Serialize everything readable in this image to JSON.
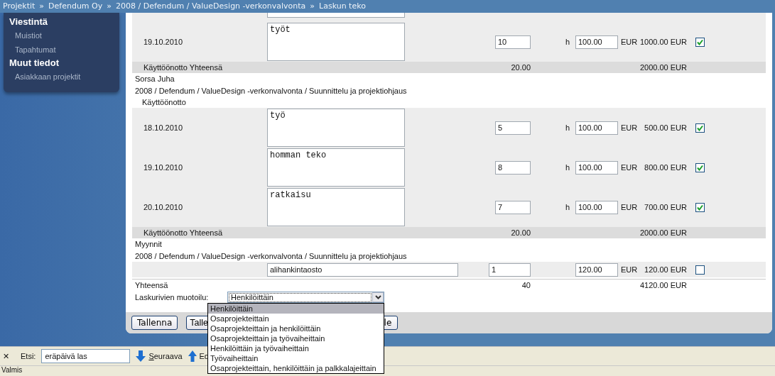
{
  "breadcrumb": [
    "Projektit",
    "Defendum Oy",
    "2008 / Defendum / ValueDesign -verkonvalvonta",
    "Laskun teko"
  ],
  "breadcrumb_separator": "»",
  "sidebar": [
    {
      "label": "Viestintä",
      "kind": "heading"
    },
    {
      "label": "Muistiot",
      "kind": "link"
    },
    {
      "label": "Tapahtumat",
      "kind": "link"
    },
    {
      "label": "Muut tiedot",
      "kind": "heading"
    },
    {
      "label": "Asiakkaan projektit",
      "kind": "link"
    }
  ],
  "lines": [
    {
      "kind": "cut_row"
    },
    {
      "kind": "row",
      "date": "19.10.2010",
      "description": "työt",
      "quantity": "10",
      "unit": "h",
      "price": "100.00",
      "currency": "EUR",
      "total": "1000.00 EUR",
      "checked": true
    },
    {
      "kind": "subtotal",
      "label": "Käyttöönotto Yhteensä",
      "quantity": "20.00",
      "total": "2000.00 EUR"
    },
    {
      "kind": "person",
      "label": "Sorsa Juha"
    },
    {
      "kind": "project",
      "label": "2008 / Defendum / ValueDesign -verkonvalvonta / Suunnittelu ja projektiohjaus"
    },
    {
      "kind": "phase",
      "label": "Käyttöönotto"
    },
    {
      "kind": "row",
      "date": "18.10.2010",
      "description": "työ",
      "quantity": "5",
      "unit": "h",
      "price": "100.00",
      "currency": "EUR",
      "total": "500.00 EUR",
      "checked": true
    },
    {
      "kind": "row",
      "date": "19.10.2010",
      "description": "homman teko",
      "quantity": "8",
      "unit": "h",
      "price": "100.00",
      "currency": "EUR",
      "total": "800.00 EUR",
      "checked": true
    },
    {
      "kind": "row",
      "date": "20.10.2010",
      "description": "ratkaisu",
      "quantity": "7",
      "unit": "h",
      "price": "100.00",
      "currency": "EUR",
      "total": "700.00 EUR",
      "checked": true
    },
    {
      "kind": "subtotal",
      "label": "Käyttöönotto Yhteensä",
      "quantity": "20.00",
      "total": "2000.00 EUR"
    },
    {
      "kind": "person",
      "label": "Myynnit"
    },
    {
      "kind": "project",
      "label": "2008 / Defendum / ValueDesign -verkonvalvonta / Suunnittelu ja projektiohjaus"
    },
    {
      "kind": "sales_row",
      "description": "alihankintaosto",
      "quantity": "1",
      "price": "120.00",
      "currency": "EUR",
      "total": "120.00 EUR",
      "checked": false
    },
    {
      "kind": "total",
      "label": "Yhteensä",
      "quantity": "40",
      "total": "4120.00 EUR"
    }
  ],
  "format": {
    "label": "Laskurivien muotoilu:",
    "value": "Henkilöittäin",
    "expanded": true,
    "options": [
      {
        "label": "Henkilöittäin",
        "selected": true
      },
      {
        "label": "Osaprojekteittain",
        "selected": false
      },
      {
        "label": "Osaprojekteittain ja henkilöittäin",
        "selected": false
      },
      {
        "label": "Osaprojekteittain ja työvaiheittain",
        "selected": false
      },
      {
        "label": "Henkilöittäin ja työvaiheittain",
        "selected": false
      },
      {
        "label": "Työvaiheittain",
        "selected": false
      },
      {
        "label": "Osaprojekteittain, henkilöittäin ja palkkalajeittain",
        "selected": false
      }
    ]
  },
  "buttons": [
    {
      "label": "Tallenna"
    },
    {
      "label": "Talle"
    },
    {
      "label": "le"
    }
  ],
  "find_bar": {
    "close": "✕",
    "label": "Etsi:",
    "value": "eräpäivä las",
    "next": "Seuraava",
    "previous": "Ed"
  },
  "status_bar": "Valmis"
}
